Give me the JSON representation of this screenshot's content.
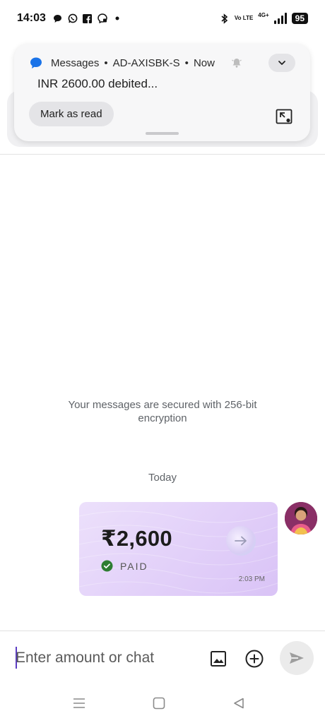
{
  "status_bar": {
    "time": "14:03",
    "left_icons": [
      "chat-bubble-icon",
      "whatsapp-icon",
      "facebook-icon",
      "messenger-icon",
      "dot-icon"
    ],
    "volte": "Vo LTE",
    "network": "4G+",
    "battery": "95"
  },
  "notification": {
    "app_name": "Messages",
    "sender": "AD-AXISBK-S",
    "time": "Now",
    "body": "INR 2600.00 debited...",
    "action_label": "Mark as read"
  },
  "conversation": {
    "secure_note_line1": "Your messages are secured with 256-bit",
    "secure_note_line2": "encryption",
    "date_separator": "Today",
    "payment": {
      "amount": "₹2,600",
      "status": "PAID",
      "time": "2:03 PM"
    }
  },
  "composer": {
    "placeholder": "Enter amount or chat"
  },
  "colors": {
    "accent": "#5b3cc4",
    "card_bg": "#e2d0f9",
    "paid_green": "#2e7d32",
    "messages_blue": "#1a73e8"
  }
}
